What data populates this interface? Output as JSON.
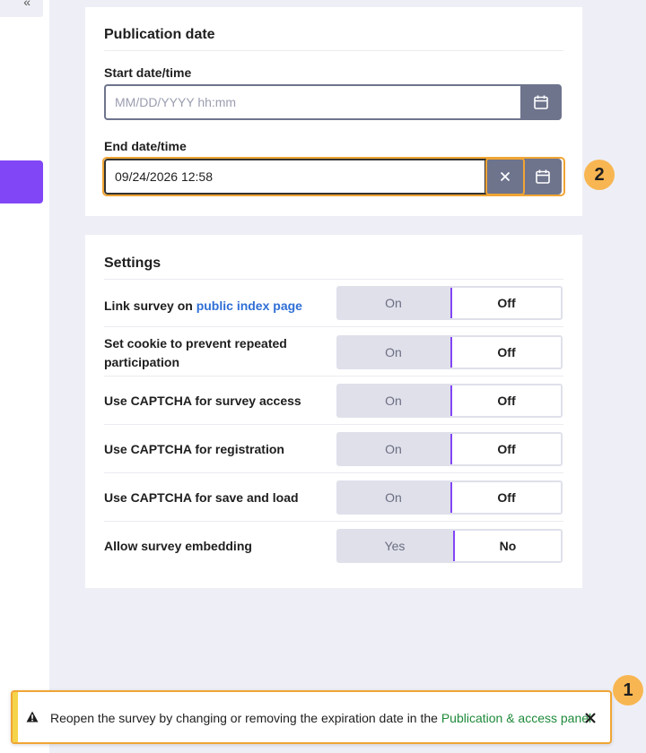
{
  "sidebar": {
    "top_glyph": "«"
  },
  "publication": {
    "title": "Publication date",
    "start_label": "Start date/time",
    "start_placeholder": "MM/DD/YYYY hh:mm",
    "start_value": "",
    "end_label": "End date/time",
    "end_value": "09/24/2026 12:58"
  },
  "settings": {
    "title": "Settings",
    "rows": [
      {
        "label": "Link survey on ",
        "link": "public index page",
        "on": "On",
        "off": "Off"
      },
      {
        "label": "Set cookie to prevent repeated participation",
        "on": "On",
        "off": "Off"
      },
      {
        "label": "Use CAPTCHA for survey access",
        "on": "On",
        "off": "Off"
      },
      {
        "label": "Use CAPTCHA for registration",
        "on": "On",
        "off": "Off"
      },
      {
        "label": "Use CAPTCHA for save and load",
        "on": "On",
        "off": "Off"
      },
      {
        "label": "Allow survey embedding",
        "on": "Yes",
        "off": "No"
      }
    ]
  },
  "badges": {
    "first": "1",
    "second": "2"
  },
  "toast": {
    "message": "Reopen the survey by changing or removing the expiration date in the ",
    "link": "Publication & access panel"
  },
  "colors": {
    "accent": "#8146f6",
    "highlight": "#f0a534",
    "badge": "#f8b652",
    "button": "#6e748c",
    "link": "#2f6fd6",
    "toast_link": "#1e8a3a"
  }
}
